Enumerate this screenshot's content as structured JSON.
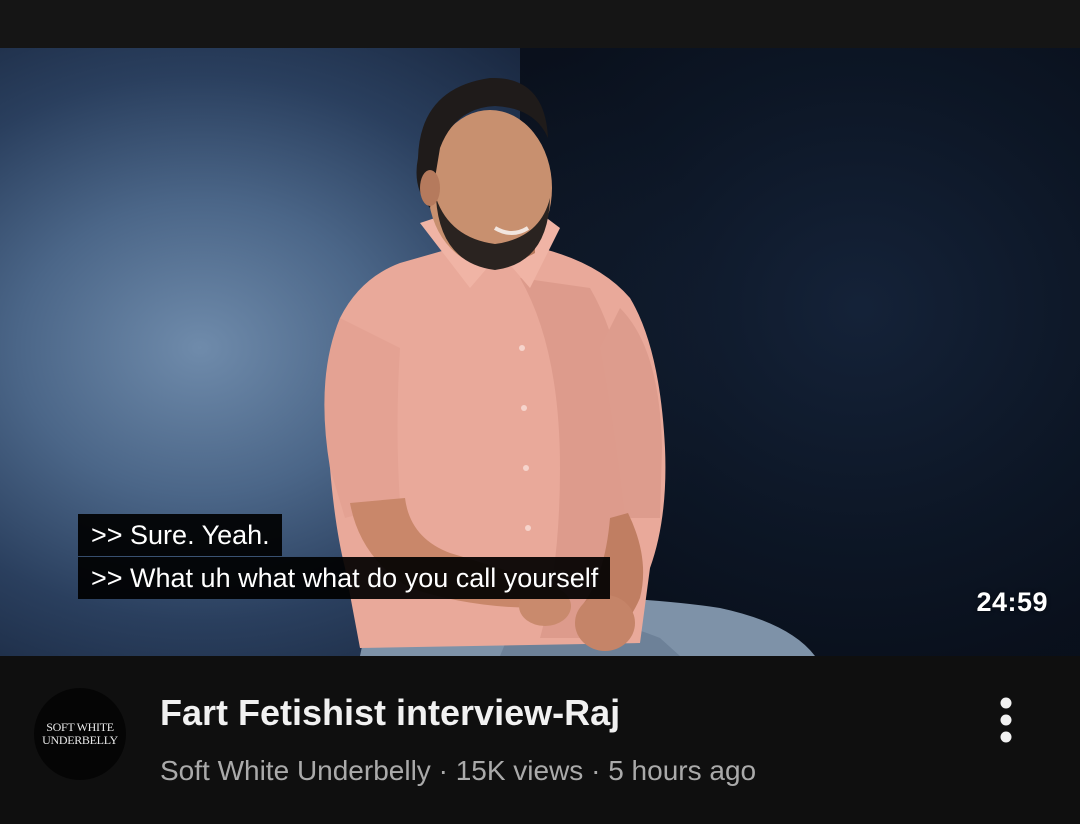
{
  "video": {
    "captions": [
      ">> Sure. Yeah.",
      ">> What uh what what do you call yourself"
    ],
    "duration": "24:59"
  },
  "details": {
    "title": "Fart Fetishist interview-Raj",
    "channel": "Soft White Underbelly",
    "views": "15K views",
    "age": "5 hours ago",
    "meta_separator": " · ",
    "avatar_text": [
      "SOFT WHITE",
      "UNDERBELLY"
    ]
  },
  "icons": {
    "menu": "more-vert-icon"
  }
}
